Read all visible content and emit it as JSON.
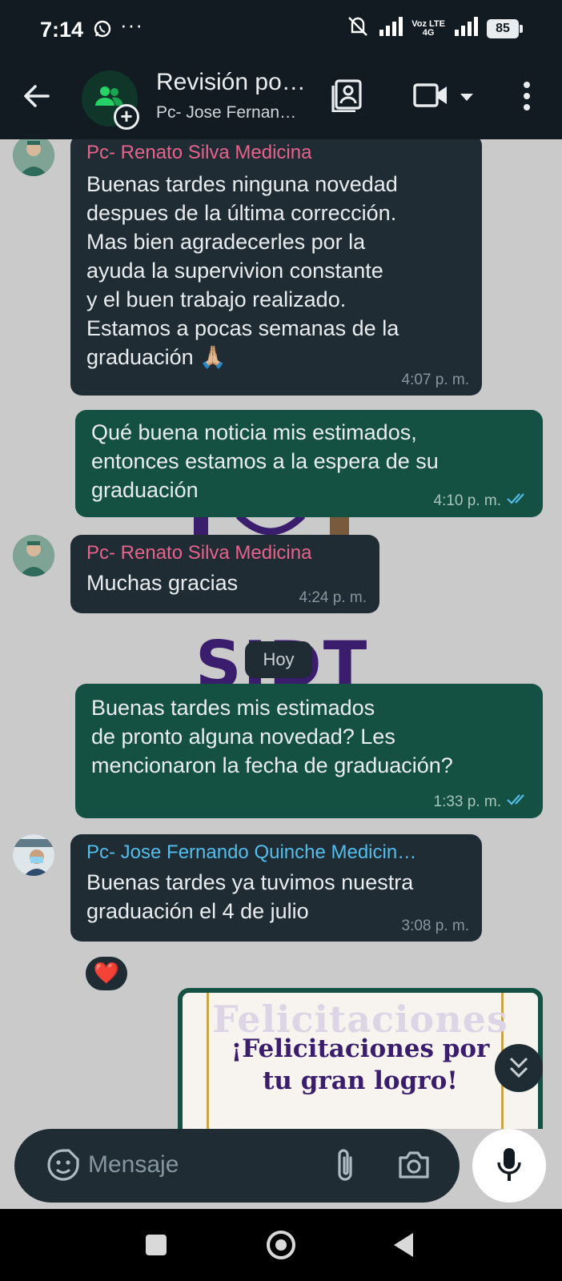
{
  "status_bar": {
    "time": "7:14",
    "more": "···",
    "volte": [
      "Voz LTE",
      "4G"
    ],
    "battery": "85"
  },
  "header": {
    "title": "Revisión po…",
    "subtitle": "Pc- Jose Fernan…",
    "icons": [
      "back-arrow-icon",
      "group-icon",
      "contacts-icon",
      "video-call-icon",
      "chevron-down-icon",
      "more-vert-icon"
    ]
  },
  "messages": [
    {
      "direction": "in",
      "sender": "Pc- Renato Silva Medicina",
      "text": "Buenas tardes ninguna novedad\ndespues de la última corrección.\nMas bien agradecerles por la\nayuda la supervivion constante\ny el buen trabajo realizado.\nEstamos a pocas semanas de la\ngraduación 🙏🏼",
      "time": "4:07 p. m."
    },
    {
      "direction": "out",
      "text": "Qué buena noticia mis estimados,\nentonces estamos a la espera de su\ngraduación",
      "time": "4:10 p. m.",
      "status": "read"
    },
    {
      "direction": "in",
      "sender": "Pc- Renato Silva Medicina",
      "text": "Muchas gracias",
      "time": "4:24 p. m."
    },
    {
      "direction": "out",
      "text": "Buenas tardes mis estimados\nde pronto alguna novedad? Les\nmencionaron la fecha de graduación?",
      "time": "1:33 p. m.",
      "status": "read"
    },
    {
      "direction": "in",
      "sender": "Pc- Jose Fernando Quinche Medicin…",
      "text": "Buenas tardes ya tuvimos nuestra\ngraduación el 4 de julio",
      "time": "3:08 p. m.",
      "reaction": "❤️"
    }
  ],
  "date_chip": "Hoy",
  "wallpaper_text": "SIDT",
  "image_message": {
    "watermark": "Felicitaciones",
    "line1": "¡Felicitaciones por",
    "line2": "tu gran logro!"
  },
  "composer": {
    "placeholder": "Mensaje"
  },
  "colors": {
    "header_bg": "#111b21",
    "incoming_bubble": "#1f2c34",
    "outgoing_bubble": "#145143",
    "sender_pink": "#e8638c",
    "sender_blue": "#53bdeb",
    "read_ticks": "#53bdeb"
  }
}
